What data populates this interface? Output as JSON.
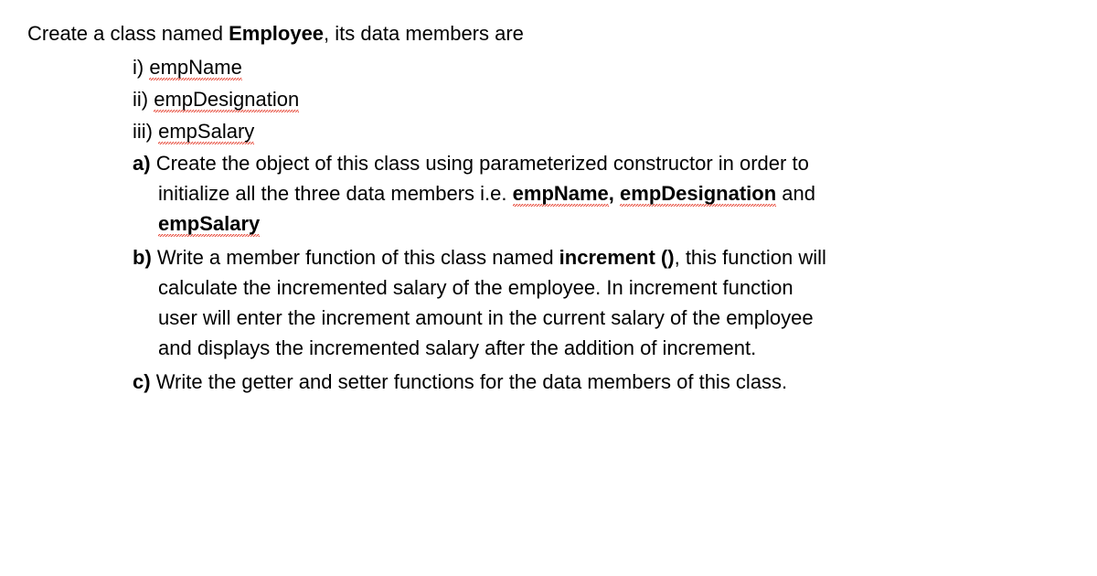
{
  "intro": {
    "prefix": "Create a class named ",
    "className": "Employee",
    "suffix": ", its data members are"
  },
  "romanItems": [
    {
      "marker": "i) ",
      "text": "empName"
    },
    {
      "marker": "ii) ",
      "text": "empDesignation"
    },
    {
      "marker": "iii) ",
      "text": "empSalary"
    }
  ],
  "alphaItems": {
    "a": {
      "marker": "a) ",
      "line1_part1": "Create the object of this class using parameterized constructor in order to",
      "line2_part1": "initialize all the three data members i.e. ",
      "line2_emp1": "empName",
      "line2_comma": ", ",
      "line2_emp2": "empDesignation",
      "line2_and": " and",
      "line3_emp3": "empSalary"
    },
    "b": {
      "marker": "b) ",
      "line1_part1": "Write a member function of this class named ",
      "line1_bold": "increment ()",
      "line1_part2": ", this function will",
      "line2": "calculate the incremented salary of the employee. In increment function",
      "line3": "user will enter the increment amount in the current salary of the employee",
      "line4": "and displays the incremented salary after the addition of increment."
    },
    "c": {
      "marker": "c) ",
      "text": "Write the getter and setter functions for the data members of this class."
    }
  }
}
